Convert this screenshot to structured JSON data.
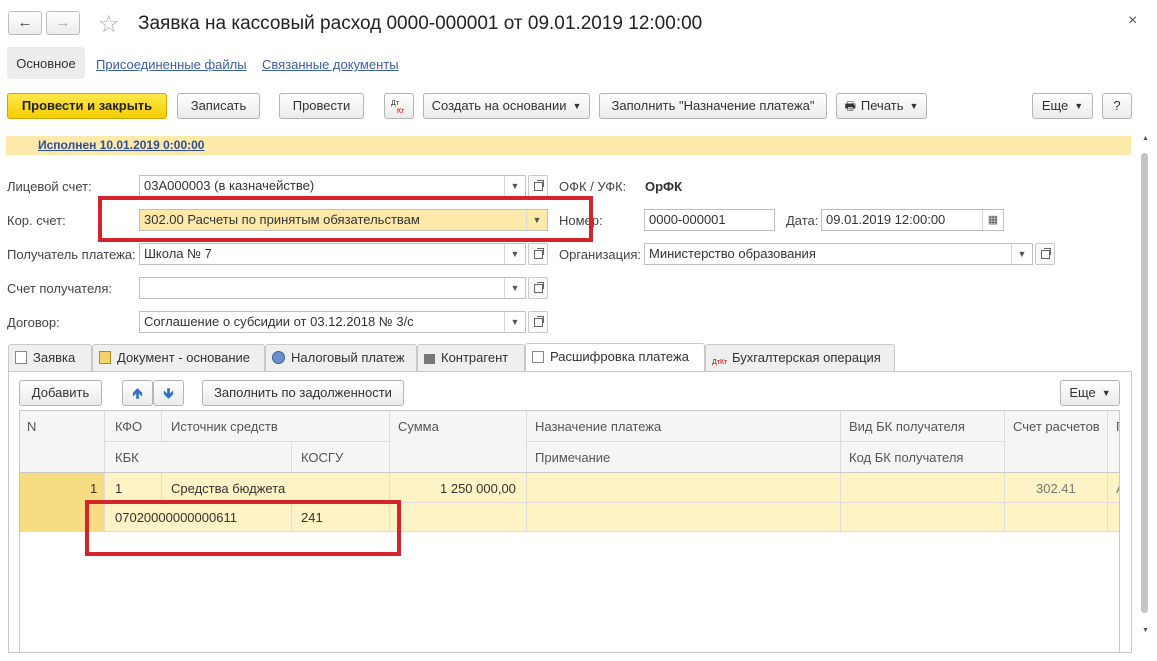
{
  "window": {
    "title": "Заявка на кассовый расход 0000-000001 от 09.01.2019 12:00:00",
    "close_label": "×"
  },
  "nav_tabs": {
    "main": "Основное",
    "attached_files": "Присоединенные файлы",
    "related_docs": "Связанные документы"
  },
  "toolbar": {
    "post_close": "Провести и закрыть",
    "save": "Записать",
    "post": "Провести",
    "create_based": "Создать на основании",
    "fill_purpose": "Заполнить \"Назначение платежа\"",
    "print": "Печать",
    "more": "Еще",
    "help": "?"
  },
  "status": {
    "text": "Исполнен 10.01.2019 0:00:00"
  },
  "form": {
    "account_label": "Лицевой счет:",
    "account_value": "03А000003 (в казначействе)",
    "ofk_label": "ОФК / УФК:",
    "ofk_value": "ОрФК",
    "kor_label": "Кор. счет:",
    "kor_value": "302.00 Расчеты по принятым обязательствам",
    "number_label": "Номер:",
    "number_value": "0000-000001",
    "date_label": "Дата:",
    "date_value": "09.01.2019 12:00:00",
    "recipient_label": "Получатель платежа:",
    "recipient_value": "Школа № 7",
    "org_label": "Организация:",
    "org_value": "Министерство образования",
    "recipient_account_label": "Счет получателя:",
    "recipient_account_value": "",
    "contract_label": "Договор:",
    "contract_value": "Соглашение о субсидии от 03.12.2018 № 3/с"
  },
  "page_tabs": [
    {
      "label": "Заявка"
    },
    {
      "label": "Документ - основание"
    },
    {
      "label": "Налоговый платеж"
    },
    {
      "label": "Контрагент"
    },
    {
      "label": "Расшифровка платежа"
    },
    {
      "label": "Бухгалтерская операция"
    }
  ],
  "table_toolbar": {
    "add": "Добавить",
    "fill_debt": "Заполнить по задолженности",
    "more": "Еще"
  },
  "table": {
    "headers": {
      "n": "N",
      "kfo": "КФО",
      "source": "Источник средств",
      "kbk": "КБК",
      "kosgu": "КОСГУ",
      "sum": "Сумма",
      "purpose": "Назначение платежа",
      "note": "Примечание",
      "bk_type": "Вид БК получателя",
      "bk_code": "Код БК получателя",
      "account": "Счет расчетов",
      "extra": "П"
    },
    "rows": [
      {
        "n": "1",
        "kfo": "1",
        "source": "Средства бюджета",
        "sum": "1 250 000,00",
        "account": "302.41",
        "extra": "А",
        "kbk": "07020000000000611",
        "kosgu": "241"
      }
    ]
  }
}
